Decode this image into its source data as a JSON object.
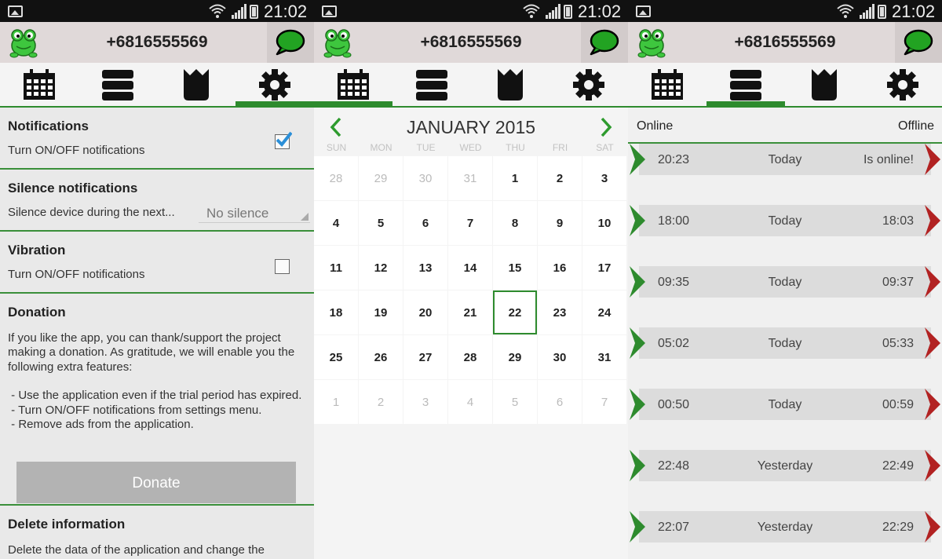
{
  "status": {
    "time": "21:02"
  },
  "appbar": {
    "phone": "+6816555569"
  },
  "tabs": [
    "calendar-icon",
    "list-icon",
    "crown-icon",
    "gear-icon"
  ],
  "settings": {
    "notifications": {
      "title": "Notifications",
      "desc": "Turn ON/OFF notifications",
      "checked": true
    },
    "silence": {
      "title": "Silence notifications",
      "desc": "Silence device during the next...",
      "value": "No silence"
    },
    "vibration": {
      "title": "Vibration",
      "desc": "Turn ON/OFF notifications",
      "checked": false
    },
    "donation": {
      "title": "Donation",
      "text": [
        "If you like the app, you can thank/support the project making a donation. As gratitude, we will enable you the following extra features:",
        "",
        " - Use the application even if the trial period has expired.",
        " - Turn ON/OFF notifications from settings menu.",
        " - Remove ads from the application."
      ],
      "button": "Donate"
    },
    "delete": {
      "title": "Delete information",
      "desc": "Delete the data of the application and change the"
    }
  },
  "calendar": {
    "title": "JANUARY 2015",
    "days": [
      "SUN",
      "MON",
      "TUE",
      "WED",
      "THU",
      "FRI",
      "SAT"
    ],
    "weeks": [
      [
        "28",
        "29",
        "30",
        "31",
        "1",
        "2",
        "3"
      ],
      [
        "4",
        "5",
        "6",
        "7",
        "8",
        "9",
        "10"
      ],
      [
        "11",
        "12",
        "13",
        "14",
        "15",
        "16",
        "17"
      ],
      [
        "18",
        "19",
        "20",
        "21",
        "22",
        "23",
        "24"
      ],
      [
        "25",
        "26",
        "27",
        "28",
        "29",
        "30",
        "31"
      ],
      [
        "1",
        "2",
        "3",
        "4",
        "5",
        "6",
        "7"
      ]
    ],
    "selected": "22"
  },
  "log": {
    "online_label": "Online",
    "offline_label": "Offline",
    "rows": [
      {
        "online": "20:23",
        "day": "Today",
        "offline": "Is online!"
      },
      {
        "online": "18:00",
        "day": "Today",
        "offline": "18:03"
      },
      {
        "online": "09:35",
        "day": "Today",
        "offline": "09:37"
      },
      {
        "online": "05:02",
        "day": "Today",
        "offline": "05:33"
      },
      {
        "online": "00:50",
        "day": "Today",
        "offline": "00:59"
      },
      {
        "online": "22:48",
        "day": "Yesterday",
        "offline": "22:49"
      },
      {
        "online": "22:07",
        "day": "Yesterday",
        "offline": "22:29"
      }
    ]
  },
  "colors": {
    "accent": "#2e8b2e",
    "offline_arrow": "#b22222",
    "donate_button": "#b3b3b3"
  }
}
